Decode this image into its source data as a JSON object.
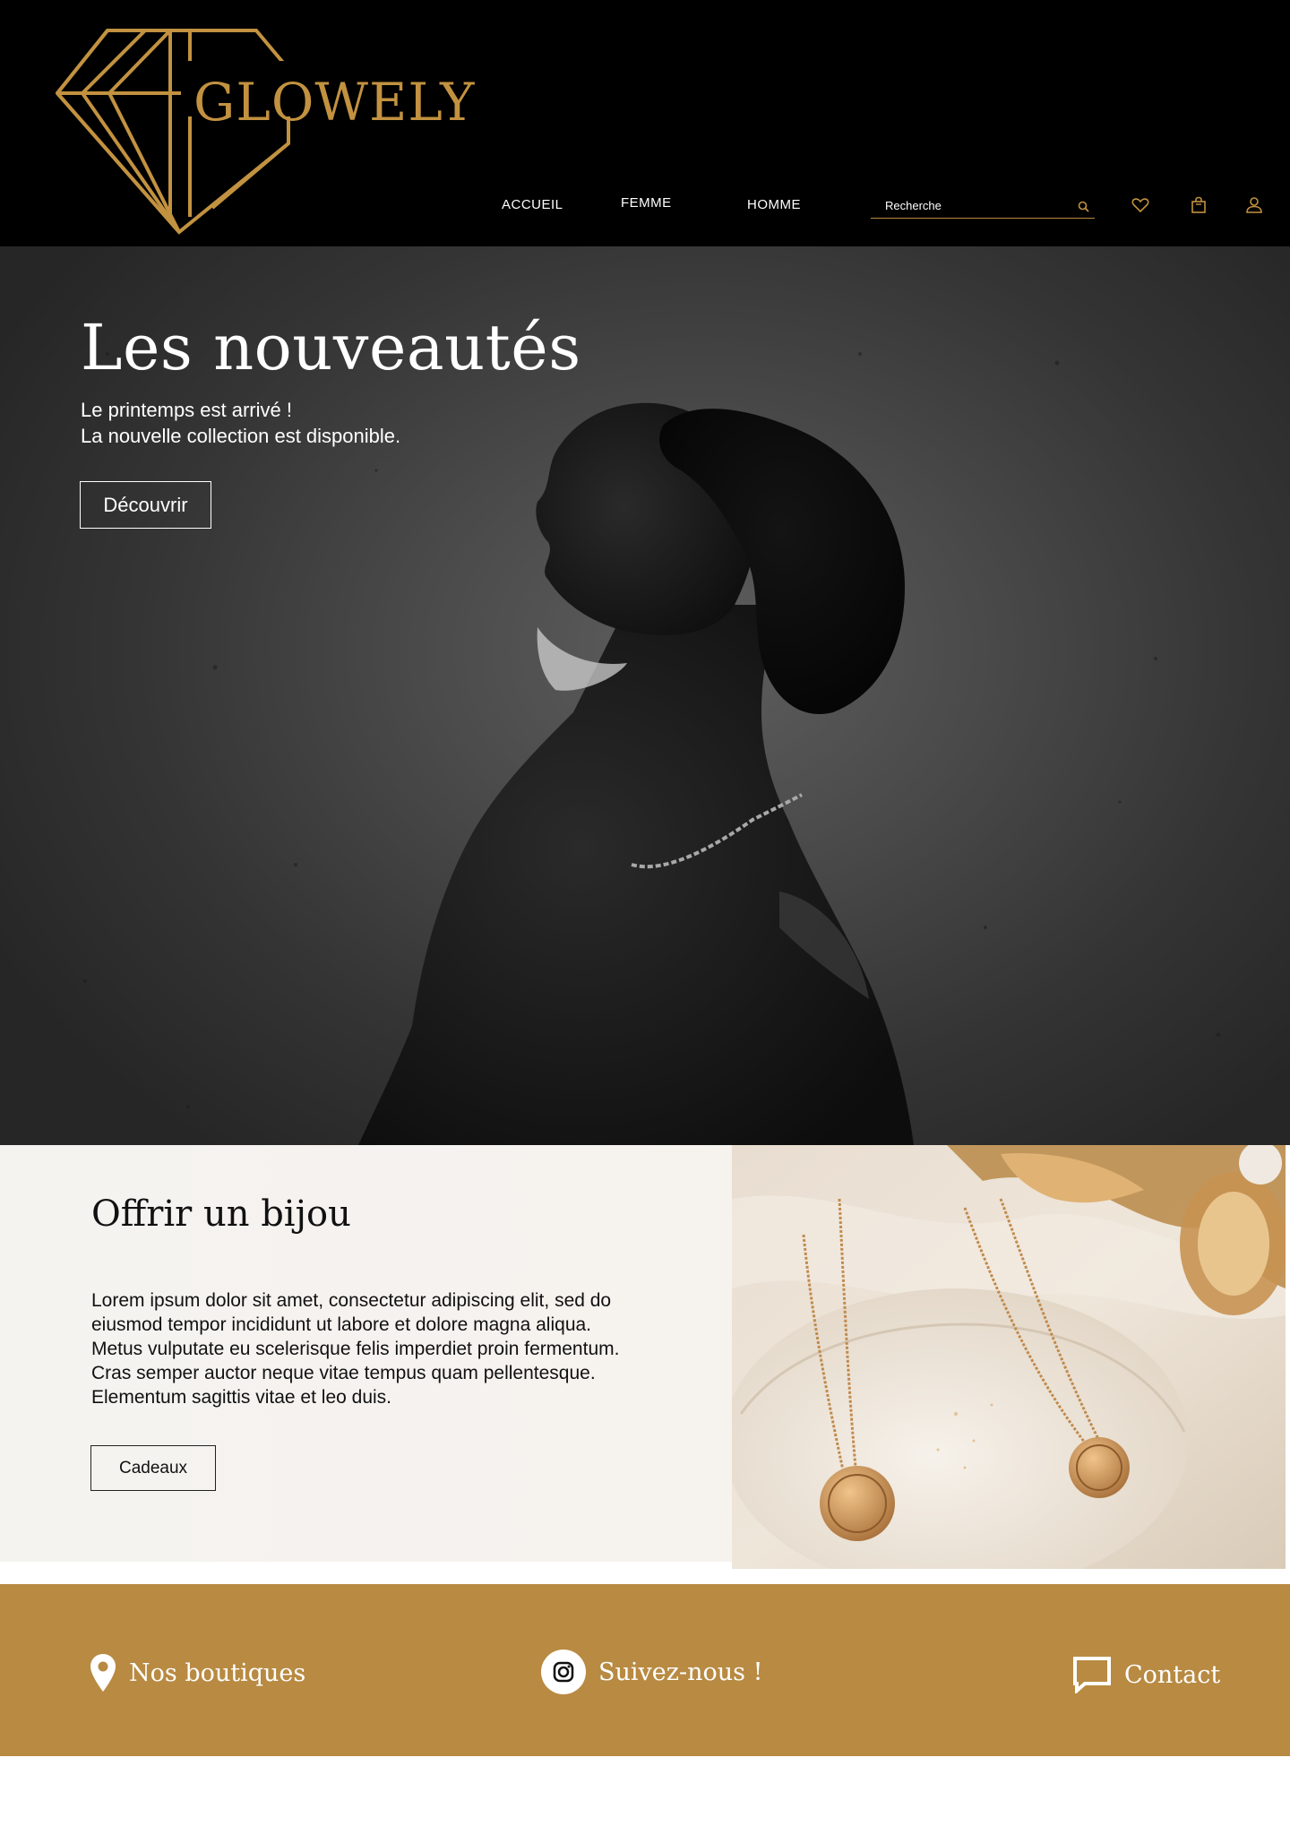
{
  "brand": {
    "name": "GLOWELY",
    "logo_icon": "diamond-logo-icon",
    "accent": "#c29240",
    "header_bg": "#000000"
  },
  "nav": {
    "items": [
      {
        "label": "ACCUEIL"
      },
      {
        "label": "FEMME"
      },
      {
        "label": "HOMME"
      }
    ],
    "search_placeholder": "Recherche",
    "icons": [
      "search-icon",
      "heart-icon",
      "bag-icon",
      "user-icon"
    ]
  },
  "hero": {
    "title": "Les nouveautés",
    "subtitle_line1": "Le printemps est arrivé !",
    "subtitle_line2": "La nouvelle collection est disponible.",
    "button": "Découvrir"
  },
  "gift": {
    "title": "Offrir un bijou",
    "text": "Lorem ipsum dolor sit amet, consectetur adipiscing elit, sed do eiusmod tempor incididunt ut labore et dolore magna aliqua. Metus vulputate eu scelerisque felis imperdiet proin fermentum. Cras semper auctor neque vitae tempus quam pellentesque. Elementum sagittis vitae et leo duis.",
    "button": "Cadeaux"
  },
  "footer": {
    "bg": "#b88a42",
    "stores": {
      "label": "Nos boutiques",
      "icon": "map-pin-icon"
    },
    "social": {
      "label": "Suivez-nous !",
      "icon": "instagram-icon"
    },
    "contact": {
      "label": "Contact",
      "icon": "chat-bubble-icon"
    }
  }
}
